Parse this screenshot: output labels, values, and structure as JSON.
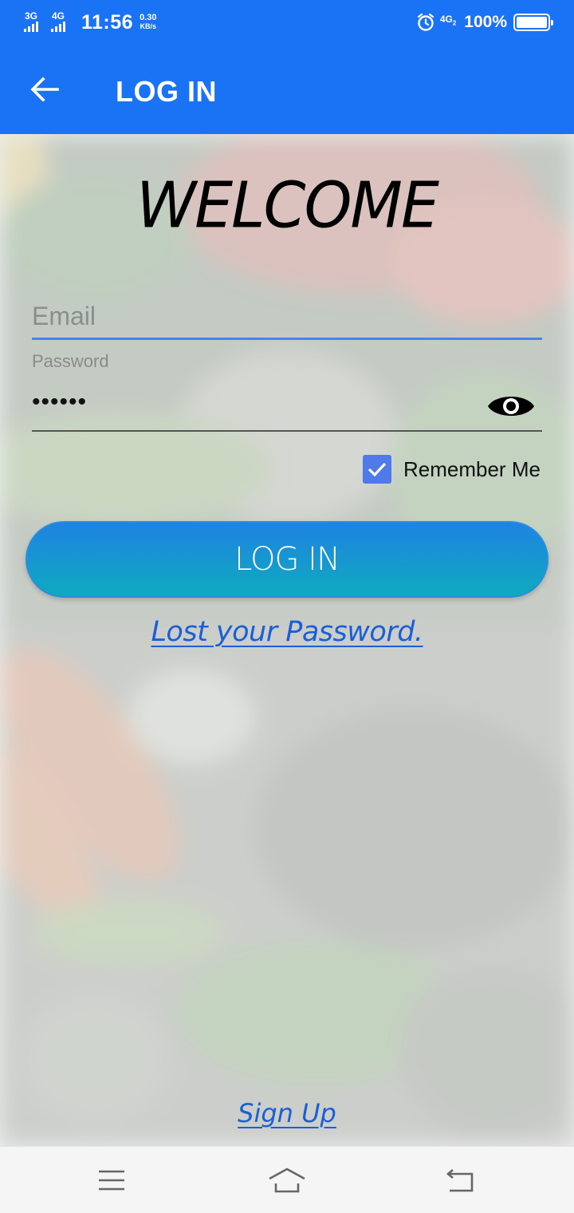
{
  "status_bar": {
    "network1": "3G",
    "network2": "4G",
    "time": "11:56",
    "speed_value": "0.30",
    "speed_unit": "KB/s",
    "network_right": "4G",
    "network_right_sub": "2",
    "battery_percent": "100%",
    "battery_level": 1.0,
    "icons": [
      "signal-icon",
      "alarm-icon",
      "battery-icon"
    ]
  },
  "app_bar": {
    "title": "LOG IN",
    "color": "#1a73f5",
    "back_icon": "arrow-left-icon"
  },
  "form": {
    "welcome": "WELCOME",
    "email_placeholder": "Email",
    "email_value": "",
    "password_label": "Password",
    "password_value": "••••••",
    "password_toggle_icon": "eye-icon",
    "remember_label": "Remember Me",
    "remember_checked": true,
    "login_button": "LOG IN",
    "lost_password": "Lost your Password."
  },
  "footer": {
    "sign_up": "Sign Up"
  },
  "nav_bar": {
    "icons": [
      "menu-icon",
      "home-icon",
      "back-icon"
    ]
  },
  "colors": {
    "accent": "#1a73f5",
    "link": "#1a5fd6",
    "checkbox": "#5079ea",
    "button_top": "#1e83e2",
    "button_bottom": "#0faabf"
  }
}
